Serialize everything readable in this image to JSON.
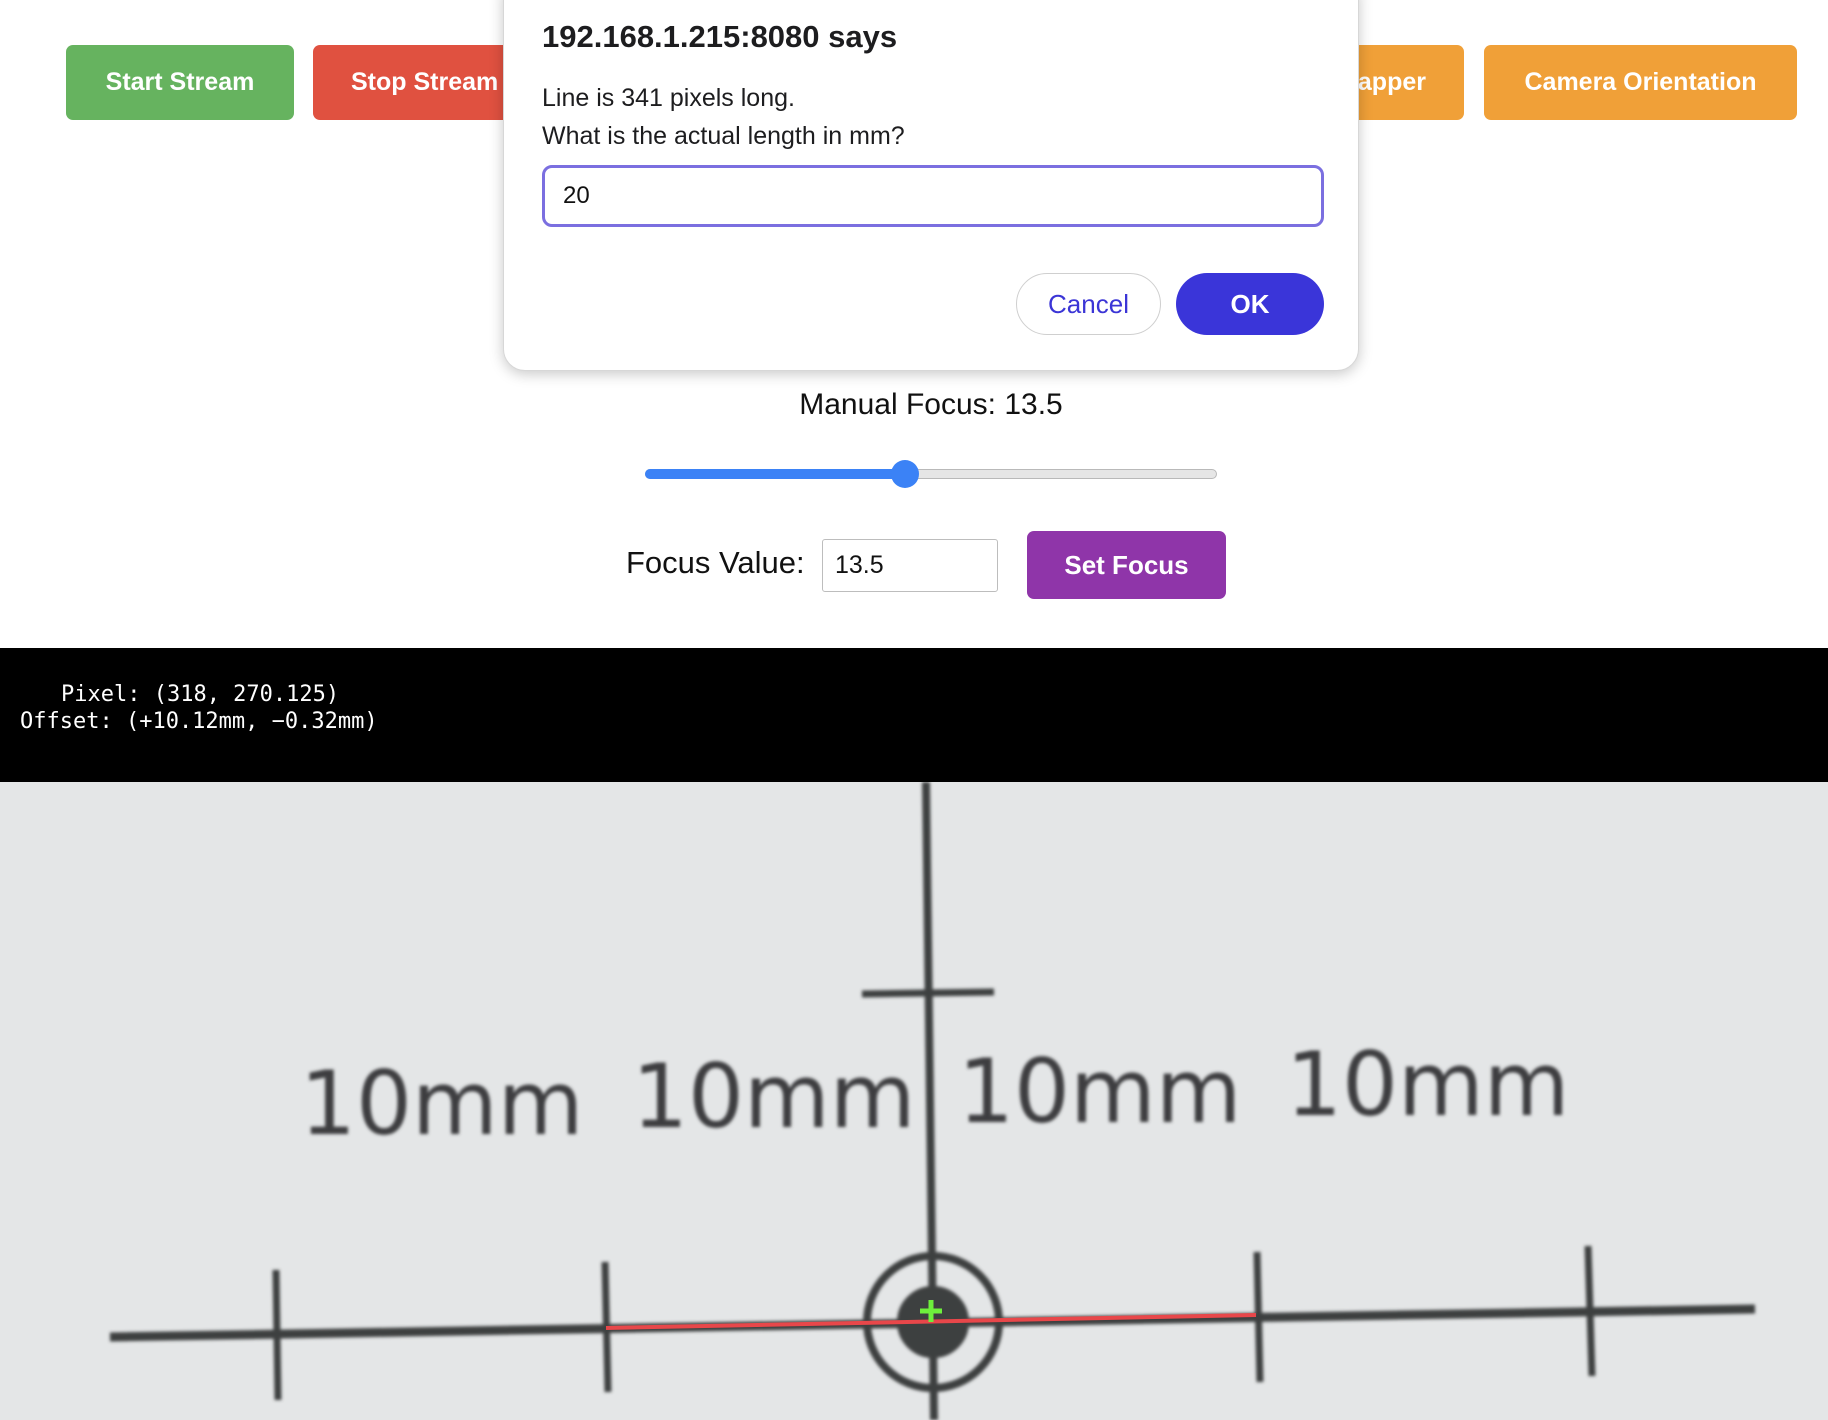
{
  "toolbar": {
    "start_stream": "Start Stream",
    "stop_stream": "Stop Stream",
    "snapper": "apper",
    "camera_orientation": "Camera Orientation"
  },
  "focus": {
    "label_text": "Manual Focus: 13.5",
    "slider_fraction": 0.455,
    "value_label": "Focus Value:",
    "input_value": "13.5",
    "set_button": "Set Focus"
  },
  "overlay": {
    "pixel_line": "Pixel: (318, 270.125)",
    "offset_line": "Offset: (+10.12mm, −0.32mm)"
  },
  "feed": {
    "scale_labels": [
      "10mm",
      "10mm",
      "10mm",
      "10mm"
    ],
    "crosshair_color": "#6ef03c",
    "measure_line_color": "#e8474a"
  },
  "dialog": {
    "title": "192.168.1.215:8080 says",
    "message_line1": "Line is 341 pixels long.",
    "message_line2": "What is the actual length in mm?",
    "input_value": "20",
    "cancel": "Cancel",
    "ok": "OK"
  },
  "colors": {
    "start": "#66b35f",
    "stop": "#e05140",
    "orange": "#f0a038",
    "set_focus": "#8f35a9",
    "slider": "#3b82f6",
    "ok": "#3a35d9"
  }
}
